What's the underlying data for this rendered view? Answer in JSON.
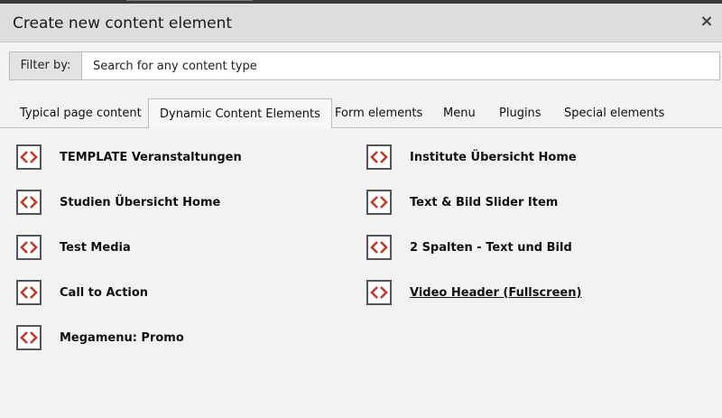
{
  "dialog": {
    "title": "Create new content element",
    "close_symbol": "×"
  },
  "filter": {
    "label": "Filter by:",
    "placeholder": "Search for any content type",
    "value": ""
  },
  "tabs": [
    {
      "label": "Typical page content",
      "active": false
    },
    {
      "label": "Dynamic Content Elements",
      "active": true
    },
    {
      "label": "Form elements",
      "active": false
    },
    {
      "label": "Menu",
      "active": false
    },
    {
      "label": "Plugins",
      "active": false
    },
    {
      "label": "Special elements",
      "active": false
    }
  ],
  "items": [
    {
      "label": "TEMPLATE Veranstaltungen",
      "icon": "code-brackets-icon"
    },
    {
      "label": "Institute Übersicht Home",
      "icon": "code-brackets-icon"
    },
    {
      "label": "Studien Übersicht Home",
      "icon": "code-brackets-icon"
    },
    {
      "label": "Text & Bild Slider Item",
      "icon": "code-brackets-icon"
    },
    {
      "label": "Test Media",
      "icon": "code-brackets-icon"
    },
    {
      "label": "2 Spalten - Text und Bild",
      "icon": "code-brackets-icon"
    },
    {
      "label": "Call to Action",
      "icon": "code-brackets-icon"
    },
    {
      "label": "Video Header (Fullscreen)",
      "icon": "code-brackets-icon",
      "hover": true
    },
    {
      "label": "Megamenu: Promo",
      "icon": "code-brackets-icon"
    }
  ],
  "colors": {
    "icon_accent": "#c0392b",
    "icon_border": "#555555"
  }
}
